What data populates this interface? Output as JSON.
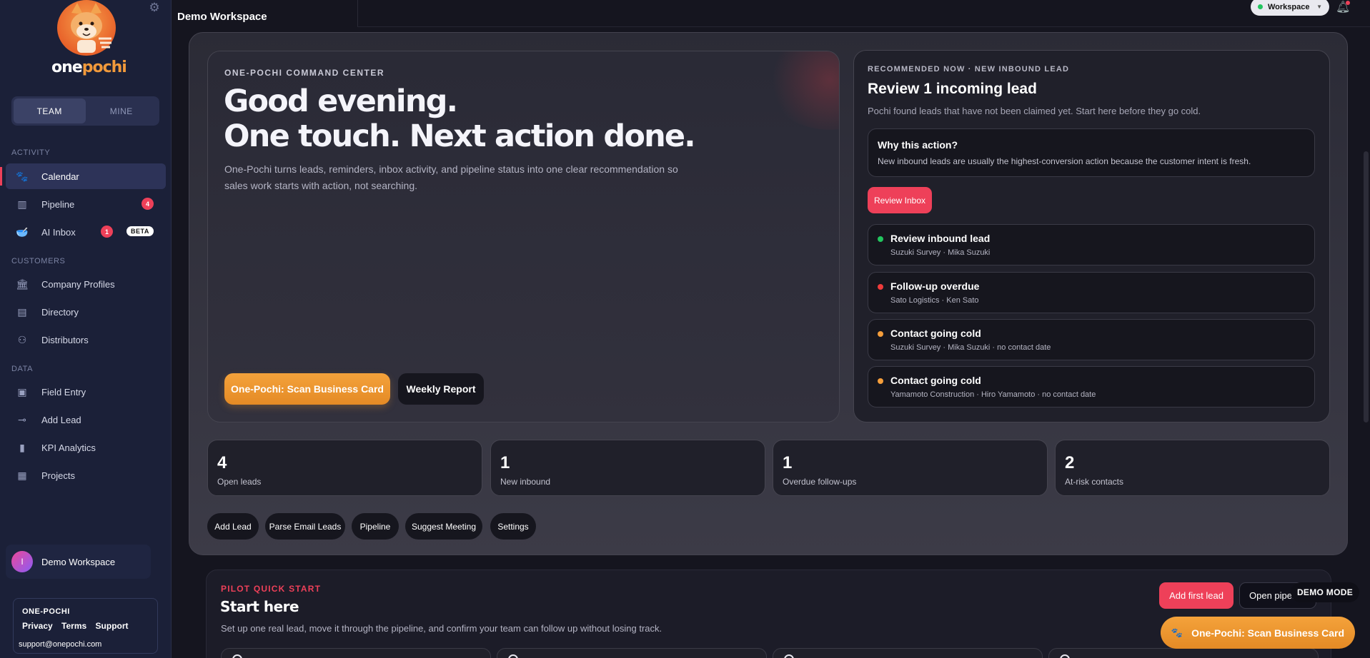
{
  "app": {
    "brand_left": "one",
    "brand_right": "pochi"
  },
  "sidebar": {
    "toggle": [
      {
        "label": "TEAM",
        "active": true
      },
      {
        "label": "MINE",
        "active": false
      }
    ],
    "sections": {
      "activity": "ACTIVITY",
      "customers": "CUSTOMERS",
      "data": "DATA"
    },
    "items": [
      {
        "label": "Calendar",
        "icon": "paw-icon",
        "active": true
      },
      {
        "label": "Pipeline",
        "icon": "pipeline-icon",
        "badge": "4"
      },
      {
        "label": "AI Inbox",
        "icon": "bowl-icon",
        "badge": "1",
        "tag": "BETA"
      },
      {
        "label": "Company Profiles",
        "icon": "building-icon"
      },
      {
        "label": "Directory",
        "icon": "book-icon"
      },
      {
        "label": "Distributors",
        "icon": "distributor-icon"
      },
      {
        "label": "Field Entry",
        "icon": "camera-icon"
      },
      {
        "label": "Add Lead",
        "icon": "plus-line-icon"
      },
      {
        "label": "KPI Analytics",
        "icon": "bar-chart-icon"
      },
      {
        "label": "Projects",
        "icon": "clipboard-icon"
      }
    ],
    "user": {
      "initial": "I",
      "name": "Demo Workspace"
    },
    "footer": {
      "title": "ONE-POCHI",
      "links": [
        "Privacy",
        "Terms",
        "Support"
      ],
      "email": "support@onepochi.com"
    }
  },
  "topbar": {
    "title": "Demo Workspace",
    "workspace_pill": "Workspace",
    "status_color": "#22c55e"
  },
  "command_center": {
    "eyebrow": "ONE-POCHI COMMAND CENTER",
    "headline_1": "Good evening.",
    "headline_2": "One touch. Next action done.",
    "description": "One-Pochi turns leads, reminders, inbox activity, and pipeline status into one clear recommendation so sales work starts with action, not searching.",
    "primary_button": "One-Pochi: Scan Business Card",
    "secondary_button": "Weekly Report"
  },
  "recommendation": {
    "eyebrow": "RECOMMENDED NOW · NEW INBOUND LEAD",
    "title": "Review 1 incoming lead",
    "subtitle": "Pochi found leads that have not been claimed yet. Start here before they go cold.",
    "why_title": "Why this action?",
    "why_text": "New inbound leads are usually the highest-conversion action because the customer intent is fresh.",
    "button": "Review Inbox",
    "tasks": [
      {
        "title": "Review inbound lead",
        "detail": "Suzuki Survey · Mika Suzuki",
        "color": "#22c55e"
      },
      {
        "title": "Follow-up overdue",
        "detail": "Sato Logistics · Ken Sato",
        "color": "#ef3b3b"
      },
      {
        "title": "Contact going cold",
        "detail": "Suzuki Survey · Mika Suzuki · no contact date",
        "color": "#f59e3b"
      },
      {
        "title": "Contact going cold",
        "detail": "Yamamoto Construction · Hiro Yamamoto · no contact date",
        "color": "#f59e3b"
      }
    ]
  },
  "kpis": [
    {
      "value": "4",
      "label": "Open leads"
    },
    {
      "value": "1",
      "label": "New inbound"
    },
    {
      "value": "1",
      "label": "Overdue follow-ups"
    },
    {
      "value": "2",
      "label": "At-risk contacts"
    }
  ],
  "quick_actions": [
    "Add Lead",
    "Parse Email Leads",
    "Pipeline",
    "Suggest Meeting",
    "Settings"
  ],
  "pilot": {
    "eyebrow": "PILOT QUICK START",
    "title": "Start here",
    "subtitle": "Set up one real lead, move it through the pipeline, and confirm your team can follow up without losing track.",
    "add_first_lead": "Add first lead",
    "open_pipeline": "Open pipeline"
  },
  "demo_mode": "DEMO MODE",
  "fab_label": "One-Pochi: Scan Business Card",
  "colors": {
    "accent_orange": "#f4a23b",
    "accent_pink": "#ee4059",
    "sidebar_bg": "#1b2038"
  }
}
